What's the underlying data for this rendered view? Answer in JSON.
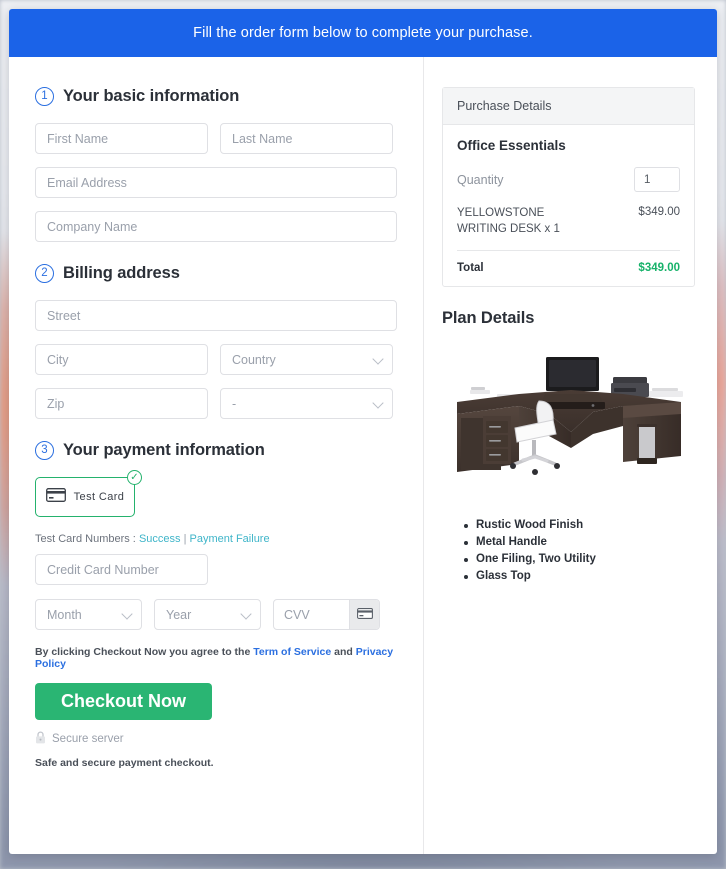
{
  "banner": {
    "text": "Fill the order form below to complete your purchase."
  },
  "steps": {
    "basic": {
      "num": "1",
      "title": "Your basic information"
    },
    "billing": {
      "num": "2",
      "title": "Billing address"
    },
    "payment": {
      "num": "3",
      "title": "Your payment information"
    }
  },
  "fields": {
    "first_name": "First Name",
    "last_name": "Last Name",
    "email": "Email Address",
    "company": "Company Name",
    "street": "Street",
    "city": "City",
    "country": "Country",
    "zip": "Zip",
    "state": "-",
    "card_number": "Credit Card Number",
    "month": "Month",
    "year": "Year",
    "cvv": "CVV"
  },
  "payment": {
    "tile_label": "Test  Card",
    "tile_icon": "credit-card-icon",
    "tile_selected_badge": "✓",
    "test_numbers_label": "Test Card Numbers :",
    "link_success": "Success",
    "link_separator": "|",
    "link_failure": "Payment Failure",
    "cvv_icon": "credit-card-icon"
  },
  "terms": {
    "prefix": "By clicking Checkout Now you agree to the",
    "tos": "Term of Service",
    "and": "and",
    "privacy": "Privacy Policy"
  },
  "actions": {
    "checkout": "Checkout Now",
    "secure_server": "Secure server",
    "lock_icon": "lock-icon",
    "safe_note": "Safe and secure payment checkout."
  },
  "purchase": {
    "header": "Purchase Details",
    "product": "Office Essentials",
    "quantity_label": "Quantity",
    "quantity_value": "1",
    "line_item": "YELLOWSTONE WRITING DESK x 1",
    "line_price": "$349.00",
    "total_label": "Total",
    "total_value": "$349.00"
  },
  "plan": {
    "title": "Plan Details",
    "image_alt": "l-shaped-office-desk-image",
    "features": [
      "Rustic Wood Finish",
      "Metal Handle",
      "One Filing, Two Utility",
      "Glass Top"
    ]
  },
  "colors": {
    "banner_blue": "#1b63e8",
    "accent_green": "#2ab573",
    "total_green": "#17b26a",
    "link_blue": "#2b6fe0",
    "link_teal": "#3fb5c9"
  }
}
